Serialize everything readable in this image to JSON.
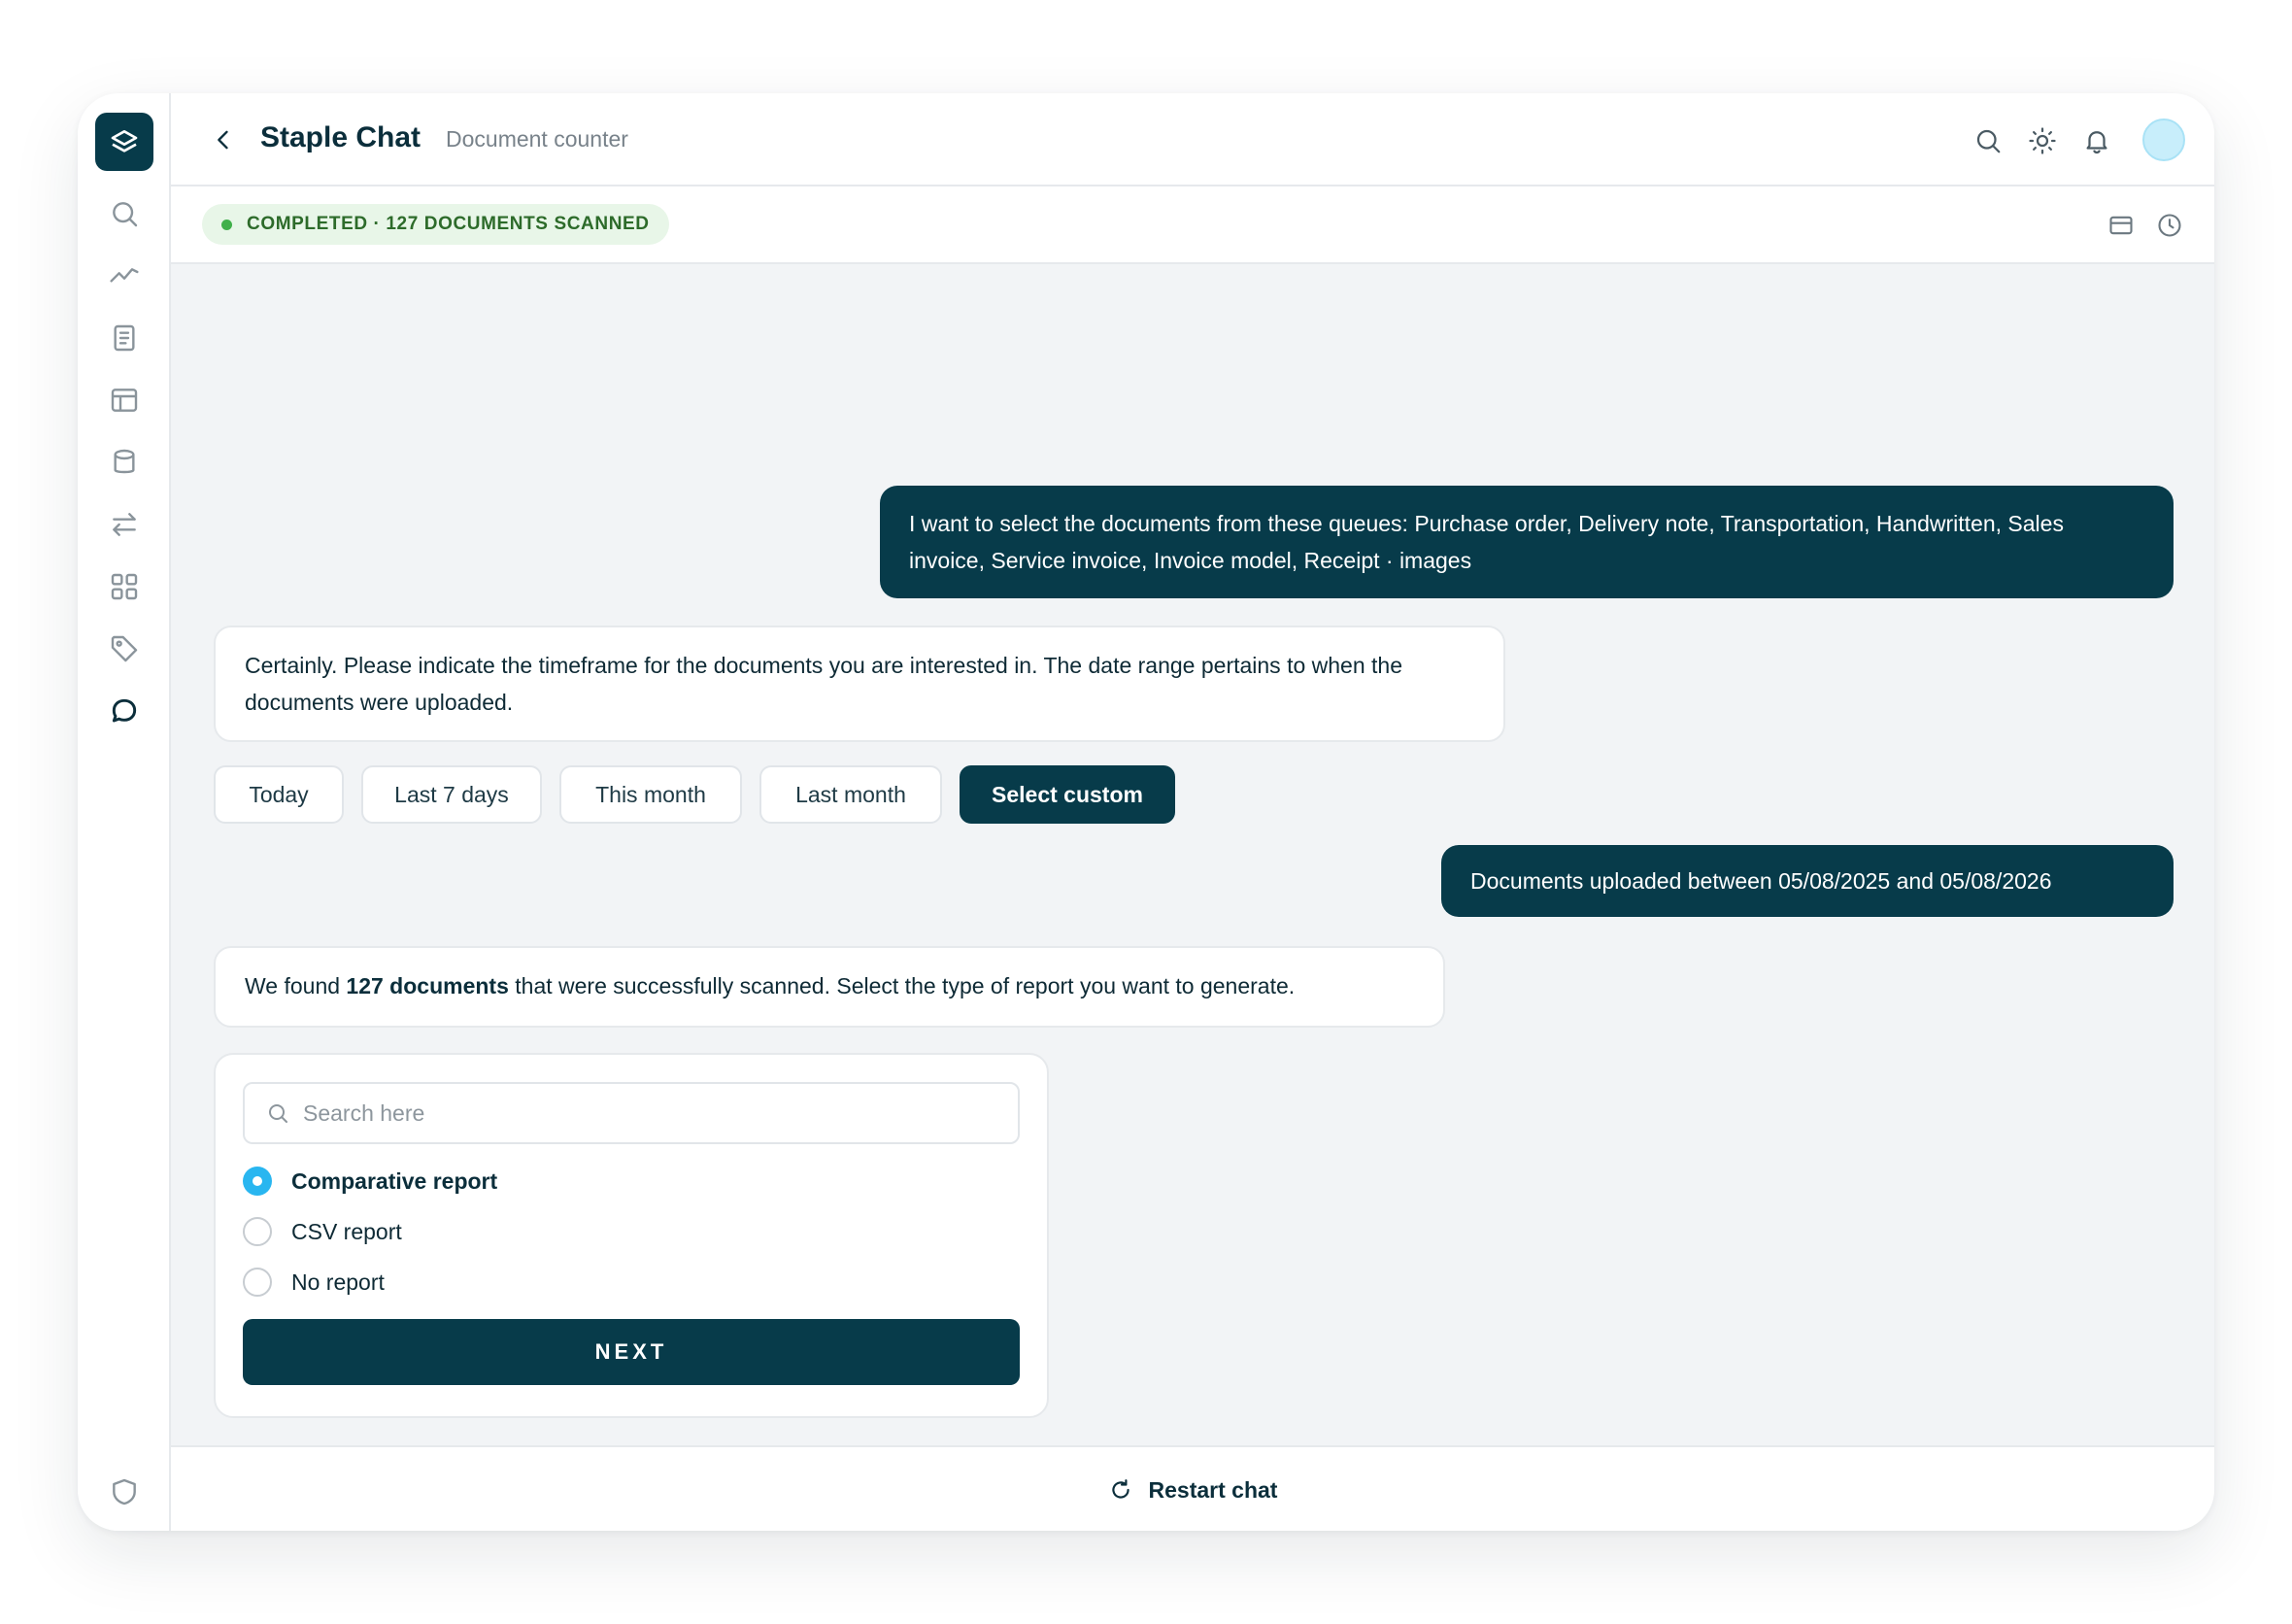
{
  "header": {
    "title": "Staple Chat",
    "subtitle": "Document counter"
  },
  "status": {
    "text": "COMPLETED · 127 DOCUMENTS SCANNED",
    "color": "#40b04a"
  },
  "sidebar": {
    "items": [
      "search-icon",
      "analytics-icon",
      "document-icon",
      "layout-icon",
      "database-icon",
      "transfer-icon",
      "apps-icon",
      "tag-icon",
      "chat-icon"
    ],
    "bottom": "shield-icon"
  },
  "chat": {
    "user_message_1": "I want to select the documents from these queues: Purchase order, Delivery note, Transportation, Handwritten, Sales invoice, Service invoice, Invoice model, Receipt · images",
    "bot_message_1": "Certainly. Please indicate the timeframe for the documents you are interested in. The date range pertains to when the documents were uploaded.",
    "timeframe_options": [
      "Today",
      "Last 7 days",
      "This month",
      "Last month",
      "Select custom"
    ],
    "selected_timeframe": "Select custom",
    "user_message_2": "Documents uploaded between 05/08/2025 and 05/08/2026",
    "bot_message_2": {
      "prefix": "We found ",
      "highlight": "127 documents",
      "suffix": " that were successfully scanned. Select the type of report you want to generate."
    }
  },
  "report": {
    "search_placeholder": "Search here",
    "options": [
      "Comparative report",
      "CSV report",
      "No report"
    ],
    "selected": "Comparative report",
    "next_label": "NEXT"
  },
  "footer": {
    "restart_label": "Restart chat"
  },
  "colors": {
    "primary": "#073b4a",
    "accent": "#29b6f0",
    "background": "#f2f4f6"
  }
}
